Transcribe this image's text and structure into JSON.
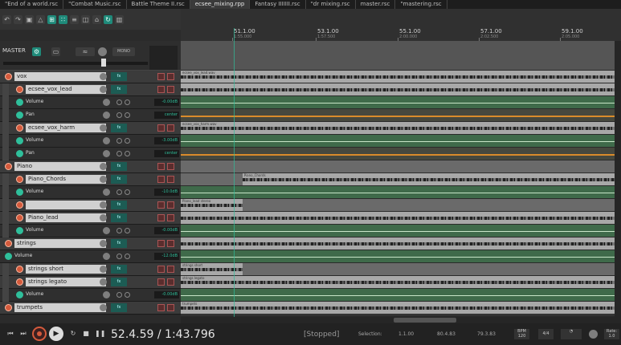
{
  "tabs": [
    "\"End of a world.rsc",
    "\"Combat Music.rsc",
    "Battle Theme II.rsc",
    "ecsee_mixing.rpp",
    "Fantasy IIIIIII.rsc",
    "\"dr mixing.rsc",
    "master.rsc",
    "\"mastering.rsc"
  ],
  "ruler": {
    "marks": [
      {
        "bar": "51.1.00",
        "time": "1:55.000"
      },
      {
        "bar": "53.1.00",
        "time": "1:57.500"
      },
      {
        "bar": "55.1.00",
        "time": "2:00.000"
      },
      {
        "bar": "57.1.00",
        "time": "2:02.500"
      },
      {
        "bar": "59.1.00",
        "time": "2:05.000"
      }
    ]
  },
  "master": {
    "label": "MASTER",
    "mono_label": "MONO"
  },
  "tracks": [
    {
      "kind": "track",
      "level": 0,
      "name": "vox",
      "val": "",
      "fx": "fx"
    },
    {
      "kind": "track",
      "level": 1,
      "name": "ecsee_vox_lead",
      "val": "",
      "fx": "fx"
    },
    {
      "kind": "env",
      "level": 1,
      "name": "Volume",
      "val": "-0.00dB"
    },
    {
      "kind": "env",
      "level": 1,
      "name": "Pan",
      "val": "center"
    },
    {
      "kind": "track",
      "level": 1,
      "name": "ecsee_vox_harm",
      "val": "",
      "fx": "fx"
    },
    {
      "kind": "env",
      "level": 1,
      "name": "Volume",
      "val": "-3.00dB"
    },
    {
      "kind": "env",
      "level": 1,
      "name": "Pan",
      "val": "center"
    },
    {
      "kind": "track",
      "level": 0,
      "name": "Piano",
      "val": "",
      "fx": "fx"
    },
    {
      "kind": "track",
      "level": 1,
      "name": "Piano_Chords",
      "val": "",
      "fx": "fx"
    },
    {
      "kind": "env",
      "level": 1,
      "name": "Volume",
      "val": "-10.0dB"
    },
    {
      "kind": "track",
      "level": 1,
      "name": "",
      "val": "",
      "fx": "fx"
    },
    {
      "kind": "track",
      "level": 1,
      "name": "Piano_lead",
      "val": "",
      "fx": "fx"
    },
    {
      "kind": "env",
      "level": 1,
      "name": "Volume",
      "val": "-0.00dB"
    },
    {
      "kind": "track",
      "level": 0,
      "name": "strings",
      "val": "",
      "fx": "fx"
    },
    {
      "kind": "env",
      "level": 0,
      "name": "Volume",
      "val": "-12.0dB"
    },
    {
      "kind": "track",
      "level": 1,
      "name": "strings short",
      "val": "",
      "fx": "fx"
    },
    {
      "kind": "track",
      "level": 1,
      "name": "strings legato",
      "val": "",
      "fx": "fx"
    },
    {
      "kind": "env",
      "level": 1,
      "name": "Volume",
      "val": "-0.00dB"
    },
    {
      "kind": "track",
      "level": 0,
      "name": "trumpets",
      "val": "",
      "fx": "fx"
    }
  ],
  "lanes": [
    {
      "kind": "trk",
      "items": [
        {
          "start": 0,
          "end": 1,
          "label": "ecsee_vox_lead.wav"
        }
      ]
    },
    {
      "kind": "trk",
      "items": [
        {
          "start": 0,
          "end": 1,
          "label": ""
        }
      ]
    },
    {
      "kind": "env",
      "line": "green"
    },
    {
      "kind": "envo",
      "line": "orange"
    },
    {
      "kind": "trk",
      "items": [
        {
          "start": 0,
          "end": 1,
          "label": "ecsee_vox_harm.wav"
        }
      ]
    },
    {
      "kind": "env",
      "line": "green"
    },
    {
      "kind": "envo",
      "line": "orange"
    },
    {
      "kind": "trk",
      "items": []
    },
    {
      "kind": "trk",
      "items": [
        {
          "start": 0.14,
          "end": 1,
          "label": "Piano_Chords"
        }
      ]
    },
    {
      "kind": "env",
      "line": "green"
    },
    {
      "kind": "trk",
      "items": [
        {
          "start": 0,
          "end": 0.14,
          "label": "Piano_lead stereo"
        }
      ]
    },
    {
      "kind": "trk",
      "items": [
        {
          "start": 0,
          "end": 1,
          "label": ""
        }
      ]
    },
    {
      "kind": "env",
      "line": "green"
    },
    {
      "kind": "trk",
      "items": [
        {
          "start": 0,
          "end": 1,
          "label": ""
        }
      ]
    },
    {
      "kind": "env",
      "line": "green"
    },
    {
      "kind": "trk",
      "items": [
        {
          "start": 0,
          "end": 0.14,
          "label": "strings short"
        }
      ]
    },
    {
      "kind": "trk",
      "items": [
        {
          "start": 0,
          "end": 1,
          "label": "strings legato"
        }
      ]
    },
    {
      "kind": "env",
      "line": "green"
    },
    {
      "kind": "trk",
      "items": [
        {
          "start": 0,
          "end": 1,
          "label": "trumpets"
        }
      ]
    }
  ],
  "transport": {
    "time": "52.4.59 / 1:43.796",
    "status": "[Stopped]",
    "selection_label": "Selection:",
    "sel_start": "1.1.00",
    "sel_end": "80.4.83",
    "sel_len": "79.3.83",
    "bpm_label": "BPM",
    "bpm": "120",
    "sig": "4/4",
    "rate_label": "Rate:",
    "rate": "1.0"
  }
}
